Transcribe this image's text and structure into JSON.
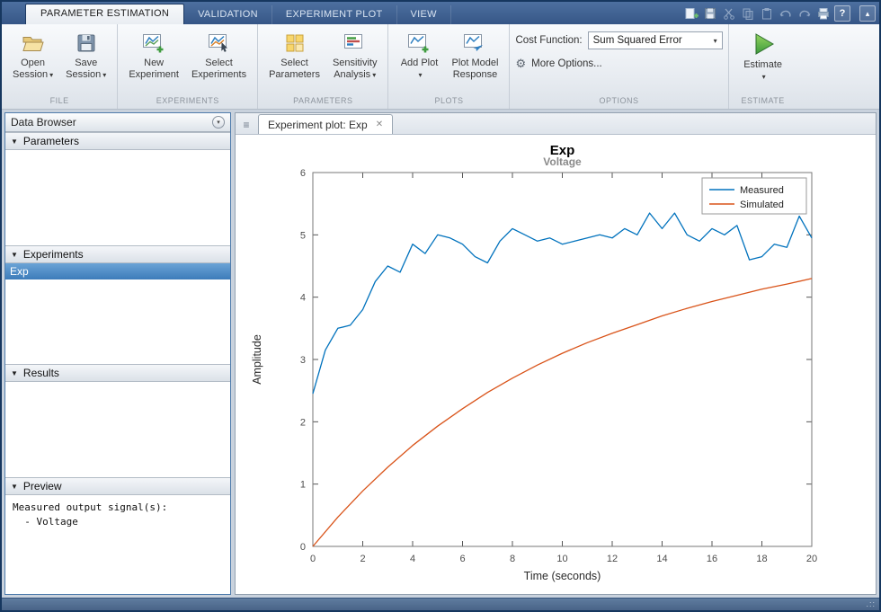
{
  "tabs": [
    {
      "label": "PARAMETER ESTIMATION",
      "active": true
    },
    {
      "label": "VALIDATION",
      "active": false
    },
    {
      "label": "EXPERIMENT PLOT",
      "active": false
    },
    {
      "label": "VIEW",
      "active": false
    }
  ],
  "glyphs": {
    "caret_down": "▾",
    "caret_up": "▴",
    "section_caret": "▼",
    "close": "✕",
    "help": "?",
    "gear": "⚙",
    "menu": "≡",
    "grip": ".::"
  },
  "ribbon": {
    "file": {
      "section_label": "FILE",
      "open_line1": "Open",
      "open_line2": "Session",
      "save_line1": "Save",
      "save_line2": "Session"
    },
    "experiments": {
      "section_label": "EXPERIMENTS",
      "new_line1": "New",
      "new_line2": "Experiment",
      "select_line1": "Select",
      "select_line2": "Experiments"
    },
    "parameters": {
      "section_label": "PARAMETERS",
      "select_line1": "Select",
      "select_line2": "Parameters",
      "sens_line1": "Sensitivity",
      "sens_line2": "Analysis"
    },
    "plots": {
      "section_label": "PLOTS",
      "addplot_label": "Add Plot",
      "pmr_line1": "Plot Model",
      "pmr_line2": "Response"
    },
    "options": {
      "section_label": "OPTIONS",
      "cost_function_label": "Cost Function:",
      "cost_function_value": "Sum Squared Error",
      "more_options_label": "More Options..."
    },
    "estimate": {
      "section_label": "ESTIMATE",
      "label": "Estimate"
    }
  },
  "sidebar": {
    "title": "Data Browser",
    "parameters_label": "Parameters",
    "experiments_label": "Experiments",
    "experiment_items": [
      {
        "label": "Exp",
        "selected": true
      }
    ],
    "results_label": "Results",
    "preview_label": "Preview",
    "preview_lines": [
      "Measured output signal(s):",
      "  - Voltage"
    ]
  },
  "document": {
    "tab_label": "Experiment plot: Exp"
  },
  "chart_data": {
    "type": "line",
    "title": "Exp",
    "subtitle": "Voltage",
    "xlabel": "Time (seconds)",
    "ylabel": "Amplitude",
    "xlim": [
      0,
      20
    ],
    "ylim": [
      0,
      6
    ],
    "xticks": [
      0,
      2,
      4,
      6,
      8,
      10,
      12,
      14,
      16,
      18,
      20
    ],
    "yticks": [
      0,
      1,
      2,
      3,
      4,
      5,
      6
    ],
    "grid": false,
    "legend_position": "top-right",
    "series": [
      {
        "name": "Measured",
        "color": "#0072BD",
        "x": [
          0,
          0.5,
          1,
          1.5,
          2,
          2.5,
          3,
          3.5,
          4,
          4.5,
          5,
          5.5,
          6,
          6.5,
          7,
          7.5,
          8,
          8.5,
          9,
          9.5,
          10,
          10.5,
          11,
          11.5,
          12,
          12.5,
          13,
          13.5,
          14,
          14.5,
          15,
          15.5,
          16,
          16.5,
          17,
          17.5,
          18,
          18.5,
          19,
          19.5,
          20
        ],
        "y": [
          2.45,
          3.15,
          3.5,
          3.55,
          3.8,
          4.25,
          4.5,
          4.4,
          4.85,
          4.7,
          5.0,
          4.95,
          4.85,
          4.65,
          4.55,
          4.9,
          5.1,
          5.0,
          4.9,
          4.95,
          4.85,
          4.9,
          4.95,
          5.0,
          4.95,
          5.1,
          5.0,
          5.35,
          5.1,
          5.35,
          5.0,
          4.9,
          5.1,
          5.0,
          5.15,
          4.6,
          4.65,
          4.85,
          4.8,
          5.3,
          4.95
        ]
      },
      {
        "name": "Simulated",
        "color": "#D95319",
        "x": [
          0,
          1,
          2,
          3,
          4,
          5,
          6,
          7,
          8,
          9,
          10,
          11,
          12,
          13,
          14,
          15,
          16,
          17,
          18,
          19,
          20
        ],
        "y": [
          0,
          0.47,
          0.89,
          1.27,
          1.62,
          1.93,
          2.21,
          2.47,
          2.7,
          2.91,
          3.1,
          3.27,
          3.42,
          3.56,
          3.7,
          3.82,
          3.93,
          4.03,
          4.13,
          4.21,
          4.3
        ]
      }
    ]
  }
}
